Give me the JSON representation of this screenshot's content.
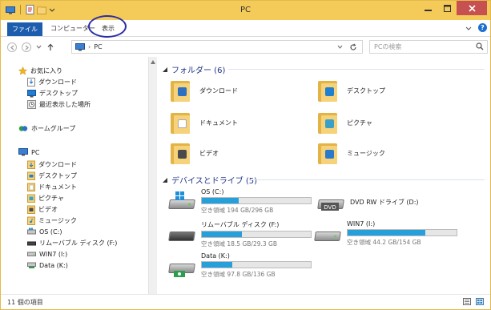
{
  "window": {
    "title": "PC"
  },
  "ribbon": {
    "file_tab": "ファイル",
    "tabs": [
      "コンピューター",
      "表示"
    ]
  },
  "address": {
    "path": "PC",
    "search_placeholder": "PCの検索"
  },
  "nav": {
    "favorites": {
      "label": "お気に入り",
      "items": [
        "ダウンロード",
        "デスクトップ",
        "最近表示した場所"
      ]
    },
    "homegroup": "ホームグループ",
    "pc": {
      "label": "PC",
      "items": [
        "ダウンロード",
        "デスクトップ",
        "ドキュメント",
        "ピクチャ",
        "ビデオ",
        "ミュージック",
        "OS (C:)",
        "リムーバブル ディスク (F:)",
        "WIN7 (I:)",
        "Data (K:)"
      ]
    }
  },
  "folders": {
    "header": "フォルダー (6)",
    "items": [
      {
        "name": "ダウンロード",
        "badge_color": "#2d6fc1"
      },
      {
        "name": "デスクトップ",
        "badge_color": "#1f7fd1"
      },
      {
        "name": "ドキュメント",
        "badge_color": "#ffffff"
      },
      {
        "name": "ピクチャ",
        "badge_color": "#3aa0c8"
      },
      {
        "name": "ビデオ",
        "badge_color": "#4b4b4b"
      },
      {
        "name": "ミュージック",
        "badge_color": "#2a7acb"
      }
    ]
  },
  "drives": {
    "header": "デバイスとドライブ (5)",
    "items": [
      {
        "name": "OS (C:)",
        "free": "空き領域 194 GB/296 GB",
        "used_fraction": 0.34,
        "has_bar": true
      },
      {
        "name": "DVD RW ドライブ (D:)",
        "free": "",
        "used_fraction": 0,
        "has_bar": false
      },
      {
        "name": "リムーバブル ディスク (F:)",
        "free": "空き領域 18.5 GB/29.3 GB",
        "used_fraction": 0.37,
        "has_bar": true
      },
      {
        "name": "WIN7 (I:)",
        "free": "空き領域 44.2 GB/154 GB",
        "used_fraction": 0.71,
        "has_bar": true
      },
      {
        "name": "Data (K:)",
        "free": "空き領域 97.8 GB/136 GB",
        "used_fraction": 0.28,
        "has_bar": true
      }
    ]
  },
  "status": {
    "item_count": "11 個の項目"
  },
  "colors": {
    "accent": "#1c5dae",
    "title_bar": "#f4ca58",
    "drive_bar": "#26a0da",
    "highlight_ring": "#2a2ea3"
  }
}
